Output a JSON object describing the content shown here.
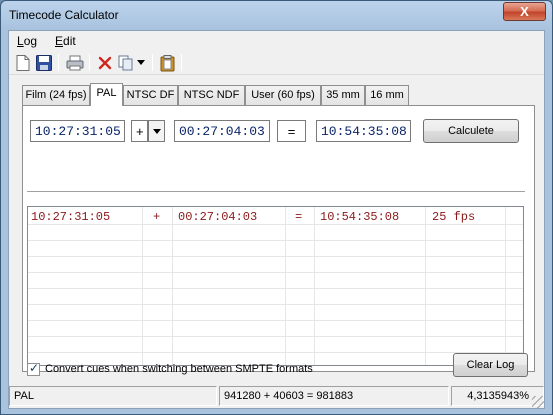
{
  "window": {
    "title": "Timecode Calculator",
    "close_label": "X"
  },
  "menubar": {
    "items": [
      {
        "label": "Log",
        "mnemonic": "L",
        "rest": "og"
      },
      {
        "label": "Edit",
        "mnemonic": "E",
        "rest": "dit"
      }
    ]
  },
  "toolbar": {
    "icons": [
      "new-document-icon",
      "save-icon",
      "print-icon",
      "delete-icon",
      "copy-icon",
      "paste-icon"
    ]
  },
  "tabs": [
    "Film (24 fps)",
    "PAL",
    "NTSC DF",
    "NTSC NDF",
    "User (60 fps)",
    "35 mm",
    "16 mm"
  ],
  "active_tab": "PAL",
  "calculator": {
    "operand1": "10:27:31:05",
    "operator": "+",
    "operand2": "00:27:04:03",
    "equals": "=",
    "result": "10:54:35:08",
    "calculate_label": "Calculete"
  },
  "log": {
    "rows": [
      {
        "a": "10:27:31:05",
        "op": "+",
        "b": "00:27:04:03",
        "eq": "=",
        "result": "10:54:35:08",
        "fps": "25 fps"
      }
    ]
  },
  "options": {
    "convert_cues_label": "Convert cues when switching between SMPTE formats",
    "convert_cues_checked": true
  },
  "clear_log_label": "Clear Log",
  "statusbar": {
    "format": "PAL",
    "frames": "941280 + 40603 = 981883",
    "percent": "4,3135943%"
  },
  "colors": {
    "timecode_text": "#0a246a",
    "log_text": "#8b1a1a"
  }
}
